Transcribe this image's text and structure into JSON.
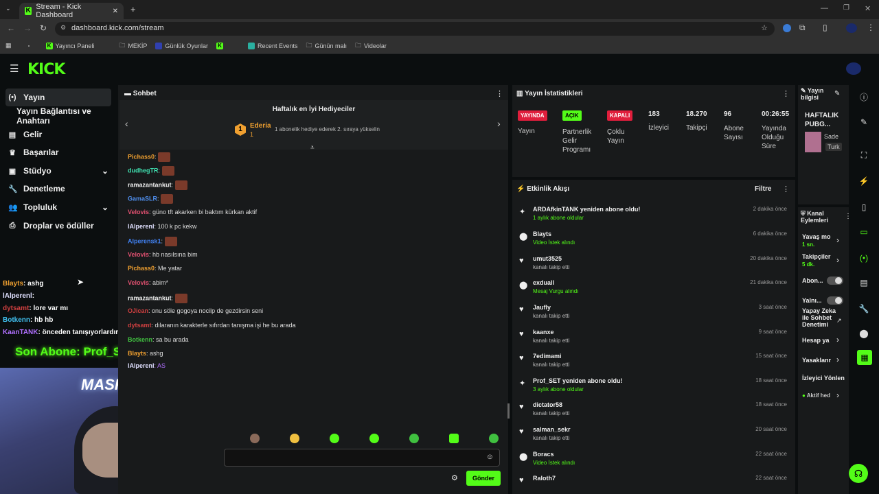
{
  "browser": {
    "tab_title": "Stream - Kick Dashboard",
    "url": "dashboard.kick.com/stream",
    "bookmarks": [
      "Yayıncı Paneli",
      "MEKİP",
      "Günlük Oyunlar",
      "Recent Events",
      "Günün malı",
      "Videolar"
    ]
  },
  "nav": {
    "items": [
      {
        "label": "Yayın",
        "icon": "broadcast-icon"
      },
      {
        "label": "Yayın Bağlantısı ve Anahtarı",
        "icon": ""
      },
      {
        "label": "Gelir",
        "icon": "income-icon"
      },
      {
        "label": "Başarılar",
        "icon": "trophy-icon"
      },
      {
        "label": "Stüdyo",
        "icon": "studio-icon"
      },
      {
        "label": "Denetleme",
        "icon": "wrench-icon"
      },
      {
        "label": "Topluluk",
        "icon": "people-icon"
      },
      {
        "label": "Droplar ve ödüller",
        "icon": "drops-icon"
      }
    ]
  },
  "overlay": {
    "chat": [
      {
        "user": "Blayts",
        "msg": ": ashg",
        "color": "#f0a030"
      },
      {
        "user": "lAlperenl",
        "msg": ": ",
        "color": "#e0e0ff"
      },
      {
        "user": "dytsamt",
        "msg": ": lore var mı",
        "color": "#d04040"
      },
      {
        "user": "Botkenn",
        "msg": ": hb hb",
        "color": "#40c0f0"
      },
      {
        "user": "KaanTANK",
        "msg": ": önceden tanışıyorlardır",
        "color": "#b070ff"
      }
    ],
    "last_sub": "Son Abone: Prof_SET",
    "cam_text": "MASKAR"
  },
  "chat": {
    "title": "Sohbet",
    "gifter_title": "Haftalık en İyi Hediyeciler",
    "gifter_name": "Ederia",
    "gifter_count": "1",
    "gifter_hint": "1 abonelik hediye ederek 2. sıraya yükselin",
    "messages": [
      {
        "user": "Pichass0",
        "text": "",
        "color": "#f0a030"
      },
      {
        "user": "dudhegTR",
        "text": "",
        "color": "#40e0b0"
      },
      {
        "user": "ramazantankut",
        "text": "",
        "color": "#f0f0f0"
      },
      {
        "user": "GamaSLR",
        "text": "",
        "color": "#5090f0"
      },
      {
        "user": "Velovis",
        "text": ": güno tft akarken bi baktım kürkan aktif",
        "color": "#e05070"
      },
      {
        "user": "lAlperenl",
        "text": ": 100 k pc kekw",
        "color": "#e0e0ff"
      },
      {
        "user": "Alperensk1",
        "text": "",
        "color": "#4080f0"
      },
      {
        "user": "Velovis",
        "text": ": hb nasılsına bim",
        "color": "#e05070"
      },
      {
        "user": "Pichass0",
        "text": ": Me yatar",
        "color": "#f0a030"
      },
      {
        "user": "Velovis",
        "text": ": abim*",
        "color": "#e05070"
      },
      {
        "user": "ramazantankut",
        "text": "",
        "color": "#f0f0f0"
      },
      {
        "user": "OJican",
        "text": ": onu söle gogoya nocilp de gezdirsin seni",
        "color": "#d04040"
      },
      {
        "user": "dytsamt",
        "text": ": dilaranın karakterle sıfırdan tanışma işi he bu arada",
        "color": "#d04040"
      },
      {
        "user": "Botkenn",
        "text": ": sa bu arada",
        "color": "#40c040"
      },
      {
        "user": "Blayts",
        "text": ": ashg",
        "color": "#f0a030"
      },
      {
        "user": "lAlperenl",
        "text": ": AS",
        "color": "#e0e0ff"
      }
    ],
    "send_label": "Gönder"
  },
  "stats": {
    "title": "Yayın İstatistikleri",
    "items": [
      {
        "badge": "YAYINDA",
        "label": "Yayın",
        "badge_color": "#e01e3c"
      },
      {
        "badge": "AÇIK",
        "label": "Partnerlik Gelir Programı",
        "badge_color": "#53fc18"
      },
      {
        "badge": "KAPALI",
        "label": "Çoklu Yayın",
        "badge_color": "#e01e3c"
      },
      {
        "value": "183",
        "label": "İzleyici"
      },
      {
        "value": "18.270",
        "label": "Takipçi"
      },
      {
        "value": "96",
        "label": "Abone Sayısı"
      },
      {
        "value": "00:26:55",
        "label": "Yayında Olduğu Süre"
      }
    ]
  },
  "activity": {
    "title": "Etkinlik Akışı",
    "filter": "Filtre",
    "items": [
      {
        "name": "ARDAfkinTANK yeniden abone oldu!",
        "sub": "1 aylık abone oldular",
        "time": "2 dakika önce",
        "icon": "sparkle-icon",
        "sub_green": true
      },
      {
        "name": "Blayts",
        "sub": "Video İstek alındı",
        "time": "6 dakika önce",
        "icon": "points-icon",
        "sub_green": true
      },
      {
        "name": "umut3525",
        "sub": "kanalı takip etti",
        "time": "20 dakika önce",
        "icon": "heart-icon",
        "sub_green": false
      },
      {
        "name": "exduall",
        "sub": "Mesaj Vurgu alındı",
        "time": "21 dakika önce",
        "icon": "points-icon",
        "sub_green": true
      },
      {
        "name": "Jaufly",
        "sub": "kanalı takip etti",
        "time": "3 saat önce",
        "icon": "heart-icon",
        "sub_green": false
      },
      {
        "name": "kaanxe",
        "sub": "kanalı takip etti",
        "time": "9 saat önce",
        "icon": "heart-icon",
        "sub_green": false
      },
      {
        "name": "7edimami",
        "sub": "kanalı takip etti",
        "time": "15 saat önce",
        "icon": "heart-icon",
        "sub_green": false
      },
      {
        "name": "Prof_SET yeniden abone oldu!",
        "sub": "3 aylık abone oldular",
        "time": "18 saat önce",
        "icon": "sparkle-icon",
        "sub_green": true
      },
      {
        "name": "dictator58",
        "sub": "kanalı takip etti",
        "time": "18 saat önce",
        "icon": "heart-icon",
        "sub_green": false
      },
      {
        "name": "salman_sekr",
        "sub": "kanalı takip etti",
        "time": "20 saat önce",
        "icon": "heart-icon",
        "sub_green": false
      },
      {
        "name": "Boracs",
        "sub": "Video İstek alındı",
        "time": "22 saat önce",
        "icon": "points-icon",
        "sub_green": true
      },
      {
        "name": "Raloth7",
        "sub": "kanalı takip etti",
        "time": "22 saat önce",
        "icon": "heart-icon",
        "sub_green": false
      }
    ]
  },
  "stream_info": {
    "title": "Yayın bilgisi",
    "game": "HAFTALIK PUBG...",
    "tag1": "Sade",
    "tag2": "Turk"
  },
  "channel_actions": {
    "title": "Kanal Eylemleri",
    "items": [
      {
        "label": "Yavaş mo",
        "sub": "1 sn."
      },
      {
        "label": "Takipçiler",
        "sub": "5 dk."
      },
      {
        "label": "Abon...",
        "sub": ""
      },
      {
        "label": "Yalnı...",
        "sub": ""
      },
      {
        "label": "Yapay Zeka ile Sohbet Denetimi",
        "sub": ""
      },
      {
        "label": "Hesap ya",
        "sub": ""
      },
      {
        "label": "Yasaklanr",
        "sub": ""
      },
      {
        "label": "İzleyici Yönlen",
        "sub": ""
      },
      {
        "label": "Aktif hed",
        "sub": ""
      }
    ]
  }
}
